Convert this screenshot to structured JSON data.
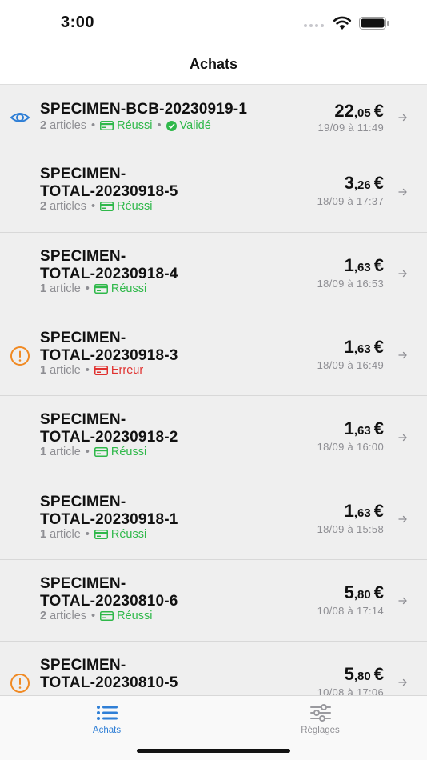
{
  "status_bar": {
    "time": "3:00"
  },
  "nav": {
    "title": "Achats"
  },
  "colors": {
    "accent": "#2f7fd6",
    "success": "#2fb84a",
    "error": "#e0312f",
    "warning": "#f08a24"
  },
  "purchases": [
    {
      "title_lines": [
        "SPECIMEN-BCB-20230919-1"
      ],
      "count_num": "2",
      "count_word": "articles",
      "status": "Réussi",
      "status_type": "ok",
      "validation": "Validé",
      "price_int": "22",
      "price_dec": ",05",
      "currency": "€",
      "date": "19/09 à 11:49",
      "lead_icon": "eye-icon"
    },
    {
      "title_lines": [
        "SPECIMEN-",
        "TOTAL-20230918-5"
      ],
      "count_num": "2",
      "count_word": "articles",
      "status": "Réussi",
      "status_type": "ok",
      "price_int": "3",
      "price_dec": ",26",
      "currency": "€",
      "date": "18/09 à 17:37"
    },
    {
      "title_lines": [
        "SPECIMEN-",
        "TOTAL-20230918-4"
      ],
      "count_num": "1",
      "count_word": "article",
      "status": "Réussi",
      "status_type": "ok",
      "price_int": "1",
      "price_dec": ",63",
      "currency": "€",
      "date": "18/09 à 16:53"
    },
    {
      "title_lines": [
        "SPECIMEN-",
        "TOTAL-20230918-3"
      ],
      "count_num": "1",
      "count_word": "article",
      "status": "Erreur",
      "status_type": "err",
      "price_int": "1",
      "price_dec": ",63",
      "currency": "€",
      "date": "18/09 à 16:49",
      "lead_icon": "warning-icon"
    },
    {
      "title_lines": [
        "SPECIMEN-",
        "TOTAL-20230918-2"
      ],
      "count_num": "1",
      "count_word": "article",
      "status": "Réussi",
      "status_type": "ok",
      "price_int": "1",
      "price_dec": ",63",
      "currency": "€",
      "date": "18/09 à 16:00"
    },
    {
      "title_lines": [
        "SPECIMEN-",
        "TOTAL-20230918-1"
      ],
      "count_num": "1",
      "count_word": "article",
      "status": "Réussi",
      "status_type": "ok",
      "price_int": "1",
      "price_dec": ",63",
      "currency": "€",
      "date": "18/09 à 15:58"
    },
    {
      "title_lines": [
        "SPECIMEN-",
        "TOTAL-20230810-6"
      ],
      "count_num": "2",
      "count_word": "articles",
      "status": "Réussi",
      "status_type": "ok",
      "price_int": "5",
      "price_dec": ",80",
      "currency": "€",
      "date": "10/08 à 17:14"
    },
    {
      "title_lines": [
        "SPECIMEN-",
        "TOTAL-20230810-5"
      ],
      "count_num": "",
      "count_word": "",
      "status": "",
      "status_type": "none",
      "price_int": "5",
      "price_dec": ",80",
      "currency": "€",
      "date": "10/08 à 17:06",
      "lead_icon": "warning-icon"
    }
  ],
  "tabs": [
    {
      "label": "Achats",
      "icon": "list-icon",
      "active": true
    },
    {
      "label": "Réglages",
      "icon": "sliders-icon",
      "active": false
    }
  ]
}
